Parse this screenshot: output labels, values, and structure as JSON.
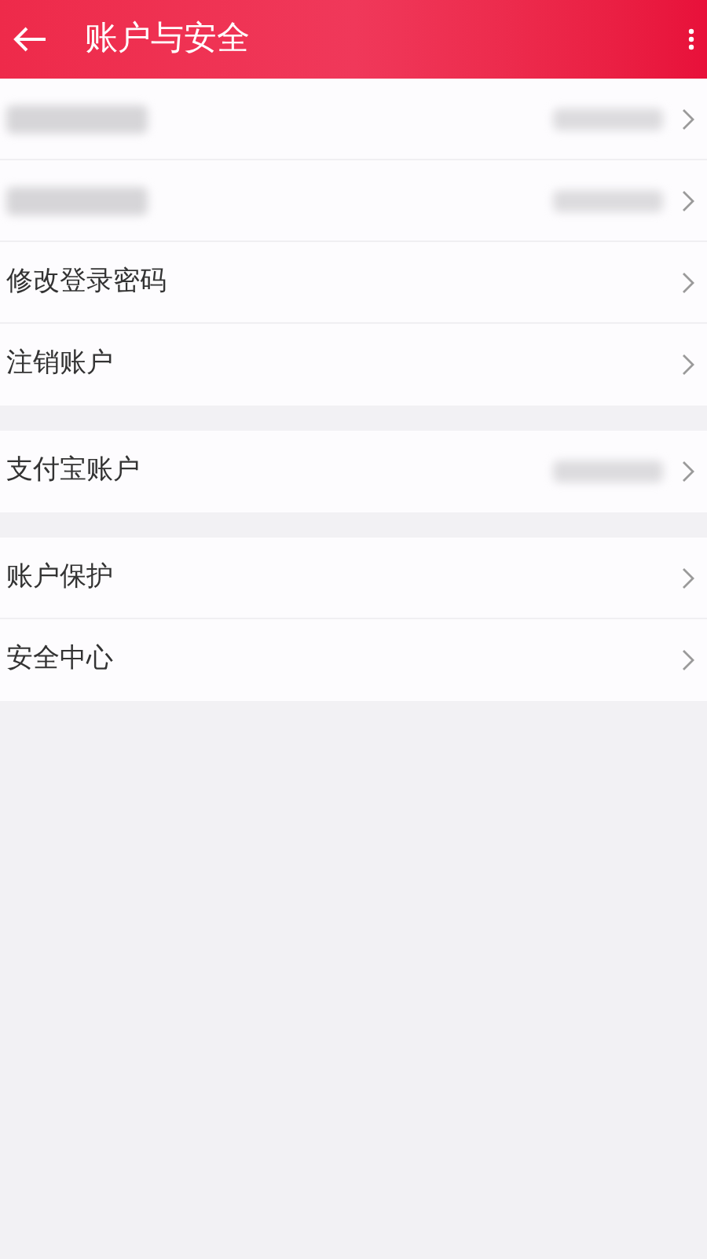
{
  "header": {
    "title": "账户与安全"
  },
  "groups": [
    {
      "items": [
        {
          "kind": "blurred",
          "value_blurred": true
        },
        {
          "kind": "blurred",
          "value_blurred": true
        },
        {
          "kind": "text",
          "label": "修改登录密码",
          "value_blurred": false
        },
        {
          "kind": "text",
          "label": "注销账户",
          "value_blurred": false
        }
      ]
    },
    {
      "items": [
        {
          "kind": "text",
          "label": "支付宝账户",
          "value_blurred": true
        }
      ]
    },
    {
      "items": [
        {
          "kind": "text",
          "label": "账户保护",
          "value_blurred": false
        },
        {
          "kind": "text",
          "label": "安全中心",
          "value_blurred": false
        }
      ]
    }
  ]
}
